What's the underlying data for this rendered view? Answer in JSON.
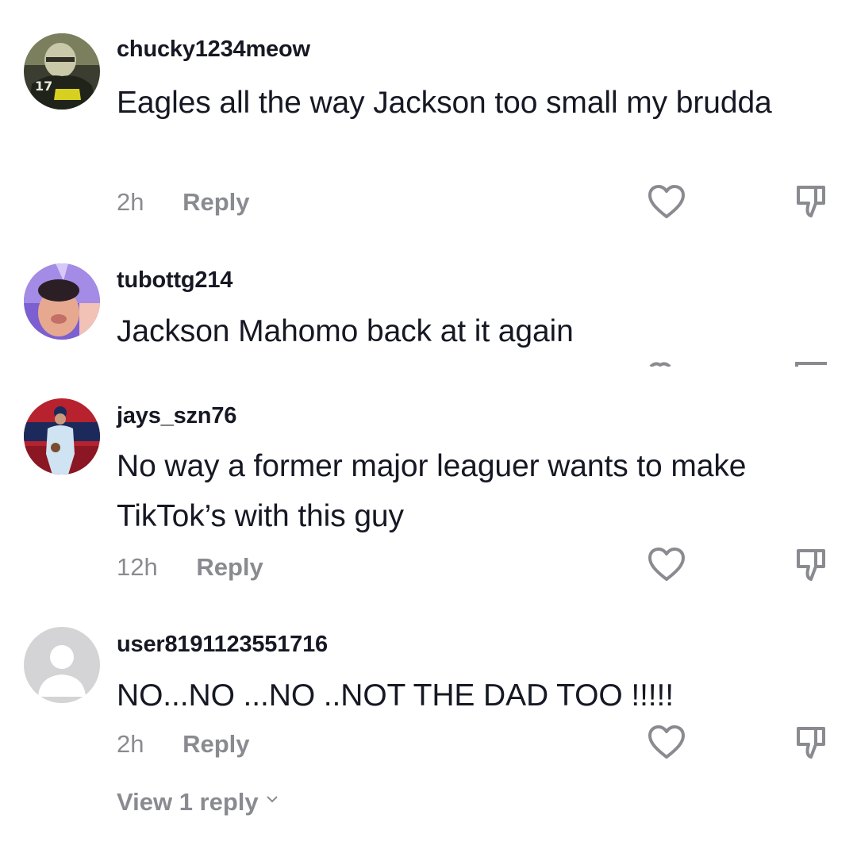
{
  "comments": [
    {
      "username": "chucky1234meow",
      "text": "Eagles all the way Jackson too small my brudda",
      "time": "2h",
      "reply_label": "Reply",
      "avatar": {
        "icon": "football-player-avatar",
        "jersey_number": "17"
      }
    },
    {
      "username": "tubottg214",
      "text": "Jackson Mahomo back at it again",
      "avatar": {
        "icon": "selfie-avatar"
      }
    },
    {
      "username": "jays_szn76",
      "text": "No way a former major leaguer wants to make TikTok’s with this guy",
      "time": "12h",
      "reply_label": "Reply",
      "avatar": {
        "icon": "baseball-player-avatar"
      }
    },
    {
      "username": "user8191123551716",
      "text": "NO...NO ...NO ..NOT THE DAD TOO !!!!!",
      "time": "2h",
      "reply_label": "Reply",
      "avatar": {
        "icon": "default-user-avatar"
      }
    }
  ],
  "view_replies": {
    "label": "View 1 reply"
  },
  "colors": {
    "text": "#161823",
    "muted": "#8a8b91",
    "icon": "#8a8b91",
    "background": "#ffffff"
  }
}
